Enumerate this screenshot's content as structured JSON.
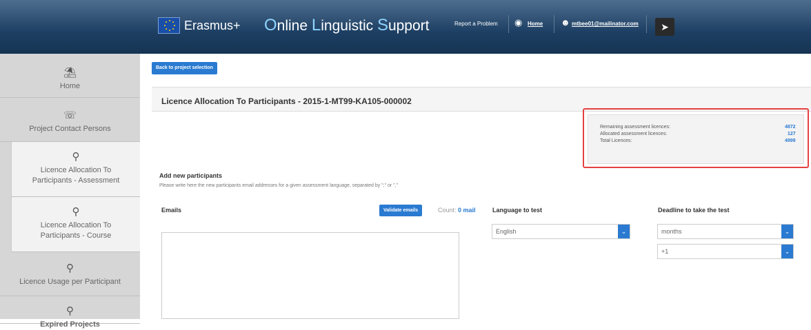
{
  "header": {
    "brand": "Erasmus+",
    "app_title_parts": [
      {
        "cap": "O",
        "rest": "nline "
      },
      {
        "cap": "L",
        "rest": "inguistic "
      },
      {
        "cap": "S",
        "rest": "upport"
      }
    ],
    "report_label": "Report a Problem",
    "home_label": "Home",
    "user_email": "mtbee01@mailinator.com"
  },
  "sidebar": {
    "items": [
      {
        "label": "Home",
        "icon": "bank-icon"
      },
      {
        "label": "Project Contact Persons",
        "icon": "contact-icon"
      },
      {
        "label": "Licence Allocation To Participants - Assessment",
        "icon": "pin-icon"
      },
      {
        "label": "Licence Allocation To Participants - Course",
        "icon": "pin-icon"
      },
      {
        "label": "Licence Usage per Participant",
        "icon": "pin-icon"
      },
      {
        "label": "Expired Projects",
        "icon": "pin-icon"
      }
    ]
  },
  "main": {
    "back_label": "Back to project selection",
    "page_title": "Licence Allocation To Participants - 2015-1-MT99-KA105-000002",
    "licences": {
      "remaining_label": "Remaining assessment licences:",
      "remaining_value": "4872",
      "allocated_label": "Allocated assessment licences:",
      "allocated_value": "127",
      "total_label": "Total Licences:",
      "total_value": "4999"
    },
    "add_title": "Add new participants",
    "add_desc": "Please write here the new participants email addresses for a given assessment language, separated by \";\" or \",\"",
    "emails_label": "Emails",
    "validate_label": "Validate emails",
    "count_label": "Count:",
    "count_value": "0 mail",
    "language_label": "Language to test",
    "language_value": "English",
    "deadline_label": "Deadline to take the test",
    "deadline_unit": "months",
    "deadline_value": "+1"
  }
}
